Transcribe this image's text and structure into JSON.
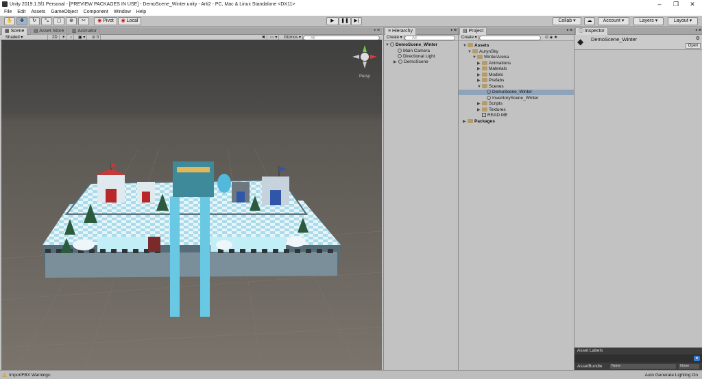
{
  "window": {
    "title": "Unity 2019.1.5f1 Personal - [PREVIEW PACKAGES IN USE] - DemoScene_Winter.unity - Arti2 - PC, Mac & Linux Standalone <DX11>"
  },
  "menu": [
    "File",
    "Edit",
    "Assets",
    "GameObject",
    "Component",
    "Window",
    "Help"
  ],
  "toolbar": {
    "pivot": "Pivot",
    "local": "Local",
    "collab": "Collab",
    "account": "Account",
    "layers": "Layers",
    "layout": "Layout"
  },
  "scene_panel": {
    "tabs": [
      "Scene",
      "Asset Store",
      "Animator"
    ],
    "shading": "Shaded",
    "mode2d": "2D",
    "fx_count": "0",
    "gizmos": "Gizmos",
    "search_placeholder": "All",
    "persp": "Persp"
  },
  "hierarchy": {
    "tab": "Hierarchy",
    "create": "Create",
    "search_placeholder": "All",
    "root": "DemoScene_Winter",
    "items": [
      "Main Camera",
      "Directional Light",
      "DemoScene"
    ]
  },
  "project": {
    "tab": "Project",
    "create": "Create",
    "items": [
      {
        "label": "Assets",
        "depth": 0,
        "type": "folder",
        "bold": true,
        "open": true
      },
      {
        "label": "AurynSky",
        "depth": 1,
        "type": "folder",
        "open": true
      },
      {
        "label": "WinterArena",
        "depth": 2,
        "type": "folder",
        "open": true
      },
      {
        "label": "Animations",
        "depth": 3,
        "type": "folder"
      },
      {
        "label": "Materials",
        "depth": 3,
        "type": "folder"
      },
      {
        "label": "Models",
        "depth": 3,
        "type": "folder"
      },
      {
        "label": "Prefabs",
        "depth": 3,
        "type": "folder"
      },
      {
        "label": "Scenes",
        "depth": 3,
        "type": "folder",
        "open": true
      },
      {
        "label": "DemoScene_Winter",
        "depth": 4,
        "type": "scene",
        "selected": true
      },
      {
        "label": "InventoryScene_Winter",
        "depth": 4,
        "type": "scene"
      },
      {
        "label": "Scripts",
        "depth": 3,
        "type": "folder"
      },
      {
        "label": "Textures",
        "depth": 3,
        "type": "folder"
      },
      {
        "label": "READ ME",
        "depth": 3,
        "type": "file"
      },
      {
        "label": "Packages",
        "depth": 0,
        "type": "folder",
        "bold": true
      }
    ]
  },
  "inspector": {
    "tab": "Inspector",
    "asset_name": "DemoScene_Winter",
    "open_button": "Open",
    "asset_labels": "Asset Labels",
    "assetbundle_label": "AssetBundle",
    "assetbundle_value": "None",
    "variant_value": "None"
  },
  "status": {
    "left": "ImportFBX Warnings:",
    "right": "Auto Generate Lighting On"
  },
  "colors": {
    "sky": "#4a4a4a",
    "ground": "#6e6962",
    "ice": "#7fd3ea",
    "snow": "#e8f3f8"
  }
}
